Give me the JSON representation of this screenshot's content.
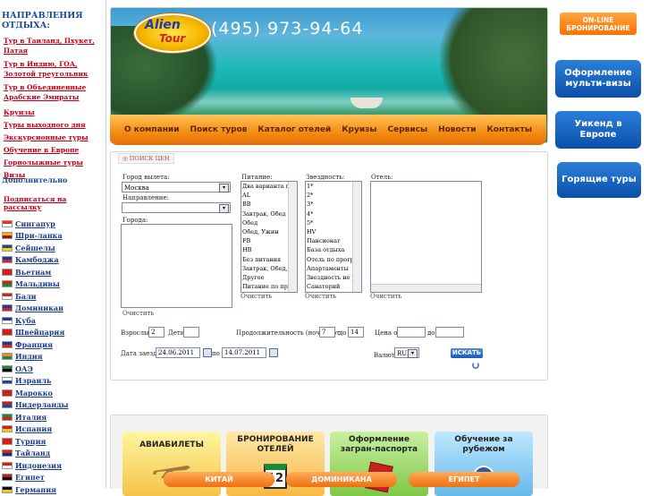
{
  "left": {
    "title": "НАПРАВЛЕНИЯ ОТДЫХА:",
    "directions": [
      {
        "label": "Тур в Таиланд, Пхукет, Патая"
      },
      {
        "label": "Тур в Индию, ГОА, Золотой треугольник"
      },
      {
        "label": "Тур в Объединенные Арабские Эмираты"
      },
      {
        "label": "Круизы"
      },
      {
        "label": "Туры выходного дня"
      },
      {
        "label": "Экскурсионные туры"
      },
      {
        "label": "Обучение в Европе"
      },
      {
        "label": "Горнолыжные туры"
      },
      {
        "label": "Визы"
      }
    ],
    "extra_title": "Дополнительно",
    "subscribe": "Подписаться на рассылку",
    "destinations": [
      {
        "label": "Сингапур",
        "colors": [
          "#e32",
          "#fff"
        ]
      },
      {
        "label": "Шри-ланка",
        "colors": [
          "#f6b400",
          "#a01020"
        ]
      },
      {
        "label": "Сейшелы",
        "colors": [
          "#1a44a8",
          "#f6d000"
        ]
      },
      {
        "label": "Камбоджа",
        "colors": [
          "#1a3a9a",
          "#d0202a"
        ]
      },
      {
        "label": "Вьетнам",
        "colors": [
          "#d8201a",
          "#d8201a"
        ]
      },
      {
        "label": "Мальдивы",
        "colors": [
          "#d8201a",
          "#1a8a3a"
        ]
      },
      {
        "label": "Бали",
        "colors": [
          "#d8201a",
          "#fff"
        ]
      },
      {
        "label": "Доминикан",
        "colors": [
          "#1a3a9a",
          "#d0202a"
        ]
      },
      {
        "label": "Куба",
        "colors": [
          "#1a3a9a",
          "#fff"
        ]
      },
      {
        "label": "Швейцария",
        "colors": [
          "#d8201a",
          "#d8201a"
        ]
      },
      {
        "label": "Франция",
        "colors": [
          "#1a3a9a",
          "#d8201a"
        ]
      },
      {
        "label": "Индия",
        "colors": [
          "#f68a20",
          "#1a8a3a"
        ]
      },
      {
        "label": "ОАЭ",
        "colors": [
          "#1a8a3a",
          "#000"
        ]
      },
      {
        "label": "Израиль",
        "colors": [
          "#fff",
          "#1a44a8"
        ]
      },
      {
        "label": "Марокко",
        "colors": [
          "#c8201a",
          "#c8201a"
        ]
      },
      {
        "label": "Нидерланды",
        "colors": [
          "#c8201a",
          "#1a44a8"
        ]
      },
      {
        "label": "Италия",
        "colors": [
          "#1a8a3a",
          "#d8201a"
        ]
      },
      {
        "label": "Испания",
        "colors": [
          "#c8201a",
          "#f6c800"
        ]
      },
      {
        "label": "Турция",
        "colors": [
          "#d8201a",
          "#d8201a"
        ]
      },
      {
        "label": "Тайланд",
        "colors": [
          "#d8201a",
          "#1a2a7a"
        ]
      },
      {
        "label": "Индонезия",
        "colors": [
          "#d8201a",
          "#fff"
        ]
      },
      {
        "label": "Египет",
        "colors": [
          "#c8201a",
          "#000"
        ]
      },
      {
        "label": "Германия",
        "colors": [
          "#000",
          "#f6c800"
        ]
      }
    ]
  },
  "header": {
    "logo_line1": "Alien",
    "logo_line2": "Tour",
    "phone": "(495) 973-94-64"
  },
  "nav": [
    "О компании",
    "Поиск туров",
    "Каталог отелей",
    "Круизы",
    "Сервисы",
    "Новости",
    "Контакты"
  ],
  "right": {
    "online": "ON-LINE БРОНИРОВАНИЕ",
    "multi_visa": "Оформление мульти-визы",
    "weekend": "Уикенд в Европе",
    "hot_tours": "Горящие туры"
  },
  "search": {
    "tab": "ПОИСК ЦЕН",
    "departure_label": "Город вылета:",
    "departure_value": "Москва",
    "direction_label": "Направление:",
    "direction_value": "",
    "cities_label": "Города:",
    "clear": "Очистить",
    "meal_label": "Питание:",
    "meal_options": [
      "Два варианта питания",
      "AL",
      "BB",
      "Завтрак, Обед",
      "Обед",
      "Обед, Ужин",
      "FB",
      "HB",
      "Без питания",
      "Завтрак, Обед, Ужин",
      "Другое",
      "Питание по программе"
    ],
    "stars_label": "Звездность:",
    "stars_options": [
      "1*",
      "2*",
      "3*",
      "4*",
      "5*",
      "HV",
      "Пансионат",
      "База отдыха",
      "Отель по программе",
      "Апартаменты",
      "Звездность не указана",
      "Санаторий"
    ],
    "hotel_label": "Отель:",
    "adults_label": "Взрослые:",
    "adults_value": "2",
    "kids_label": "Дети:",
    "kids_value": "",
    "nights_label": "Продолжительность (ночей) от",
    "nights_from": "7",
    "nights_to_label": "до",
    "nights_to": "14",
    "price_label": "Цена от",
    "price_from": "",
    "price_to_label": "до",
    "price_to": "",
    "date_label": "Дата заезда с",
    "date_from": "24.06.2011",
    "date_to_label": "по",
    "date_to": "14.07.2011",
    "currency_label": "Валюта",
    "currency_value": "RUR",
    "search_button": "ИСКАТЬ"
  },
  "tiles": {
    "avia": "АВИАБИЛЕТЫ",
    "hotel": "БРОНИРОВАНИЕ ОТЕЛЕЙ",
    "passport": "Оформление загран-паспорта",
    "education": "Обучение за рубежом",
    "calendar_day": "12"
  },
  "countries": [
    "КИТАЙ",
    "ДОМИНИКАНА",
    "ЕГИПЕТ"
  ]
}
